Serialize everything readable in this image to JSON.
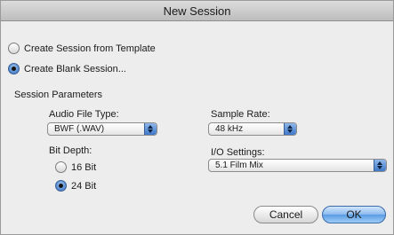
{
  "window": {
    "title": "New Session"
  },
  "source": {
    "options": [
      {
        "label": "Create Session from Template",
        "selected": false
      },
      {
        "label": "Create Blank Session...",
        "selected": true
      }
    ]
  },
  "params": {
    "title": "Session Parameters",
    "audio_file_type": {
      "label": "Audio File Type:",
      "value": "BWF (.WAV)"
    },
    "sample_rate": {
      "label": "Sample Rate:",
      "value": "48 kHz"
    },
    "bit_depth": {
      "label": "Bit Depth:",
      "options": [
        {
          "label": "16 Bit",
          "selected": false
        },
        {
          "label": "24 Bit",
          "selected": true
        }
      ]
    },
    "io_settings": {
      "label": "I/O Settings:",
      "value": "5.1 Film Mix"
    }
  },
  "buttons": {
    "cancel": "Cancel",
    "ok": "OK"
  },
  "colors": {
    "default_button": "#5a9be2",
    "radio_selected": "#3a6db3"
  },
  "icons": {
    "popup_arrows": "updown-arrows-icon"
  }
}
